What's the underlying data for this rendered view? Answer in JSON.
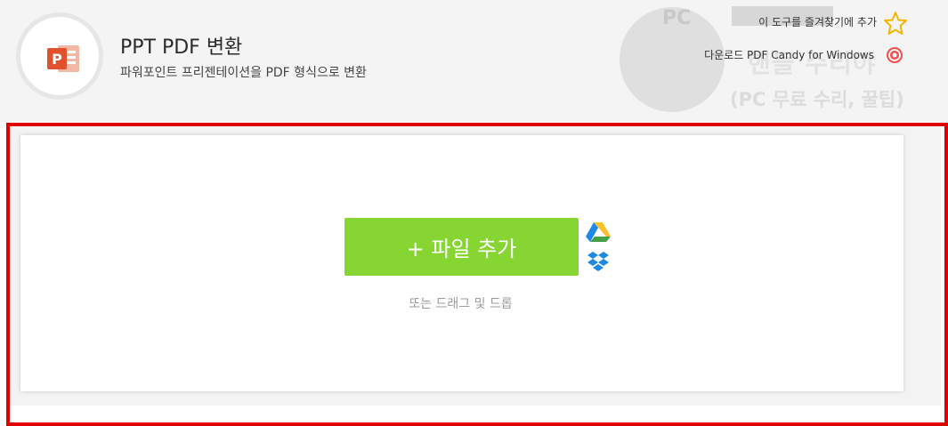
{
  "header": {
    "title": "PPT PDF 변환",
    "subtitle": "파워포인트 프리젠테이션을 PDF 형식으로 변환",
    "links": {
      "favorite": "이 도구를 즐겨찾기에 추가",
      "download": "다운로드 PDF Candy for Windows"
    }
  },
  "watermark": {
    "pc": "PC",
    "name": "핸들 수리야",
    "sub": "(PC 무료 수리, 꿀팁)"
  },
  "upload": {
    "add_button": "+ 파일 추가",
    "hint": "또는 드래그 및 드롭"
  },
  "icons": {
    "app": "powerpoint-icon",
    "favorite": "star-icon",
    "download": "candy-icon",
    "cloud_1": "google-drive-icon",
    "cloud_2": "dropbox-icon"
  },
  "colors": {
    "accent_button": "#86d532",
    "highlight_frame": "#e00000",
    "ppt_brand": "#e0512c"
  }
}
